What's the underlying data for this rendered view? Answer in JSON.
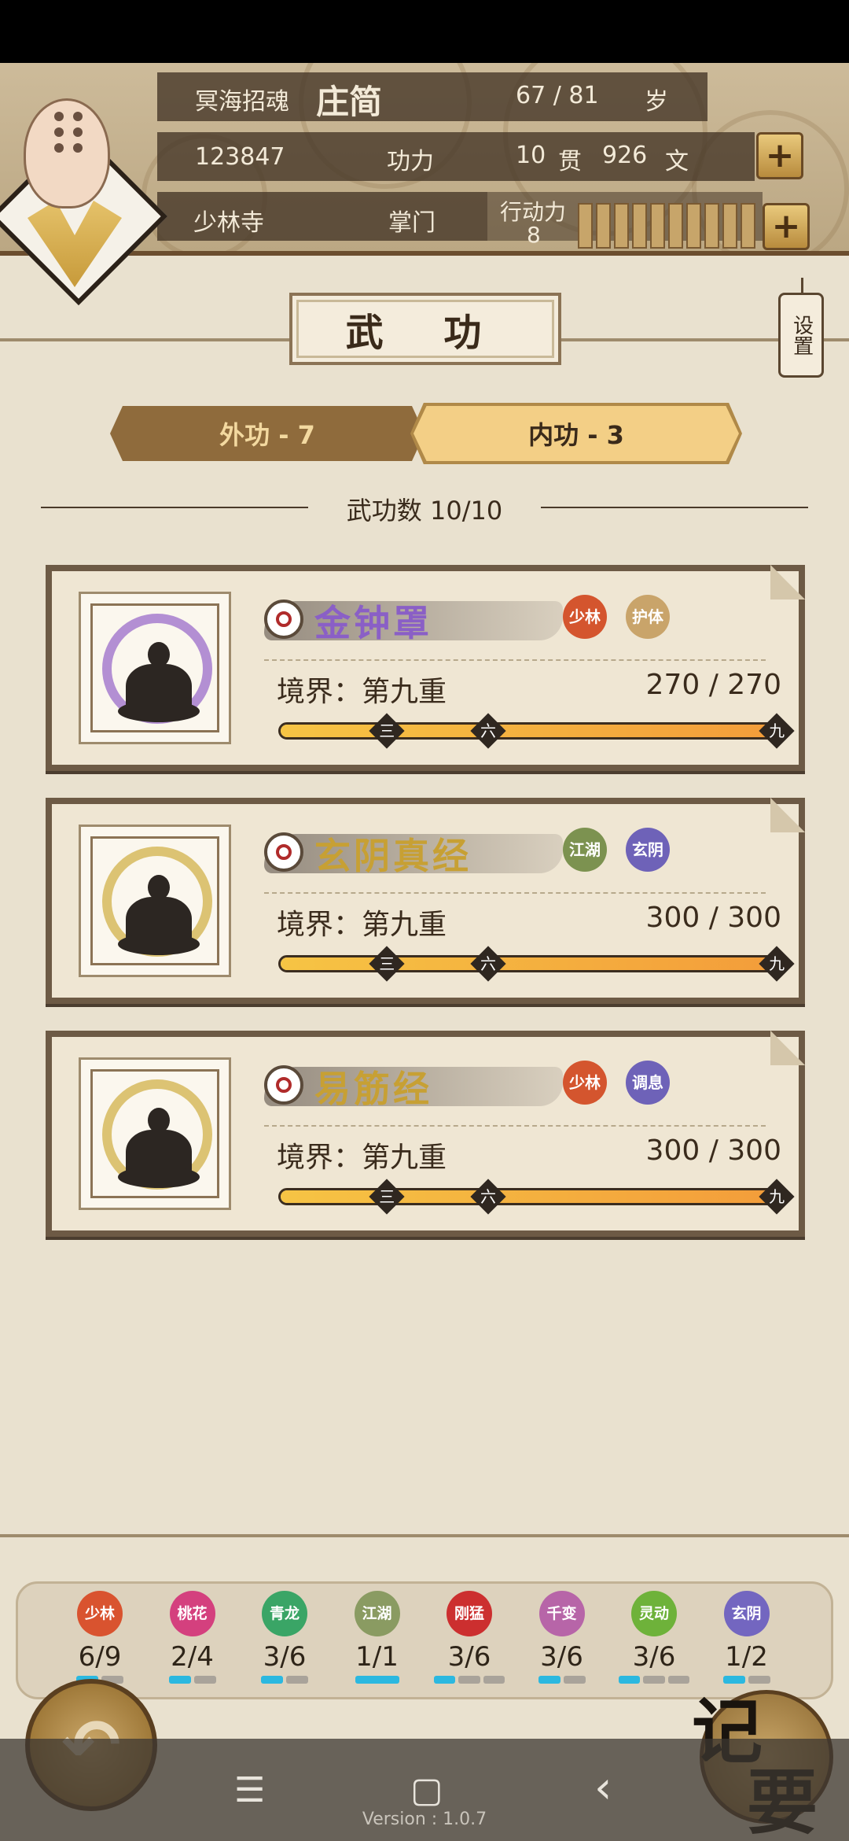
{
  "header": {
    "title_label": "冥海招魂",
    "name": "庄简",
    "age": "67 / 81",
    "age_unit": "岁",
    "power_value": "123847",
    "power_label": "功力",
    "money_guan": "10",
    "money_guan_unit": "贯",
    "money_wen": "926",
    "money_wen_unit": "文",
    "sect": "少林寺",
    "rank": "掌门",
    "action_label": "行动力",
    "action_value": "8",
    "energy_fraction": 1.0
  },
  "page_title": "武 功",
  "settings_label": "设置",
  "tabs": [
    {
      "label": "外功 - 7",
      "active": false
    },
    {
      "label": "内功 - 3",
      "active": true
    }
  ],
  "skill_count": "武功数 10/10",
  "skills": [
    {
      "name": "金钟罩",
      "name_color": "#8a5fc6",
      "ring_color": "#9b6cc9",
      "tags": [
        {
          "text": "少林",
          "color": "#d4552e"
        },
        {
          "text": "护体",
          "color": "#c9a46a"
        }
      ],
      "realm": "境界：第九重",
      "progress": "270 / 270",
      "fill": 1.0,
      "markers": [
        "三",
        "六",
        "九"
      ]
    },
    {
      "name": "玄阴真经",
      "name_color": "#c7a034",
      "ring_color": "#d2b14a",
      "tags": [
        {
          "text": "江湖",
          "color": "#7c9250"
        },
        {
          "text": "玄阴",
          "color": "#6e62b8"
        }
      ],
      "realm": "境界：第九重",
      "progress": "300 / 300",
      "fill": 1.0,
      "markers": [
        "三",
        "六",
        "九"
      ]
    },
    {
      "name": "易筋经",
      "name_color": "#c7a034",
      "ring_color": "#d2b14a",
      "tags": [
        {
          "text": "少林",
          "color": "#d4552e"
        },
        {
          "text": "调息",
          "color": "#6e62b8"
        }
      ],
      "realm": "境界：第九重",
      "progress": "300 / 300",
      "fill": 1.0,
      "markers": [
        "三",
        "六",
        "九"
      ]
    }
  ],
  "schools": [
    {
      "label": "少林",
      "count": "6/9",
      "color": "#d9532f",
      "pips": [
        1,
        0
      ],
      "pip_color": "#2bb8e0"
    },
    {
      "label": "桃花",
      "count": "2/4",
      "color": "#d4407e",
      "pips": [
        1,
        0
      ],
      "pip_color": "#2bb8e0"
    },
    {
      "label": "青龙",
      "count": "3/6",
      "color": "#3aa566",
      "pips": [
        1,
        0
      ],
      "pip_color": "#2bb8e0"
    },
    {
      "label": "江湖",
      "count": "1/1",
      "color": "#8a9b62",
      "pips": [
        1
      ],
      "pip_color": "#2bb8e0"
    },
    {
      "label": "刚猛",
      "count": "3/6",
      "color": "#cc2f2f",
      "pips": [
        1,
        0,
        0
      ],
      "pip_color": "#2bb8e0"
    },
    {
      "label": "千变",
      "count": "3/6",
      "color": "#b765a8",
      "pips": [
        1,
        0
      ],
      "pip_color": "#2bb8e0"
    },
    {
      "label": "灵动",
      "count": "3/6",
      "color": "#6eb23a",
      "pips": [
        1,
        0,
        0
      ],
      "pip_color": "#2bb8e0"
    },
    {
      "label": "玄阴",
      "count": "1/2",
      "color": "#7366c0",
      "pips": [
        1,
        0
      ],
      "pip_color": "#2bb8e0"
    }
  ],
  "memo_label_1": "记",
  "memo_label_2": "要",
  "back_icon": "back-arrow-icon",
  "nav": {
    "menu": "☰",
    "home": "▢",
    "back": "‹"
  },
  "version": "Version : 1.0.7"
}
